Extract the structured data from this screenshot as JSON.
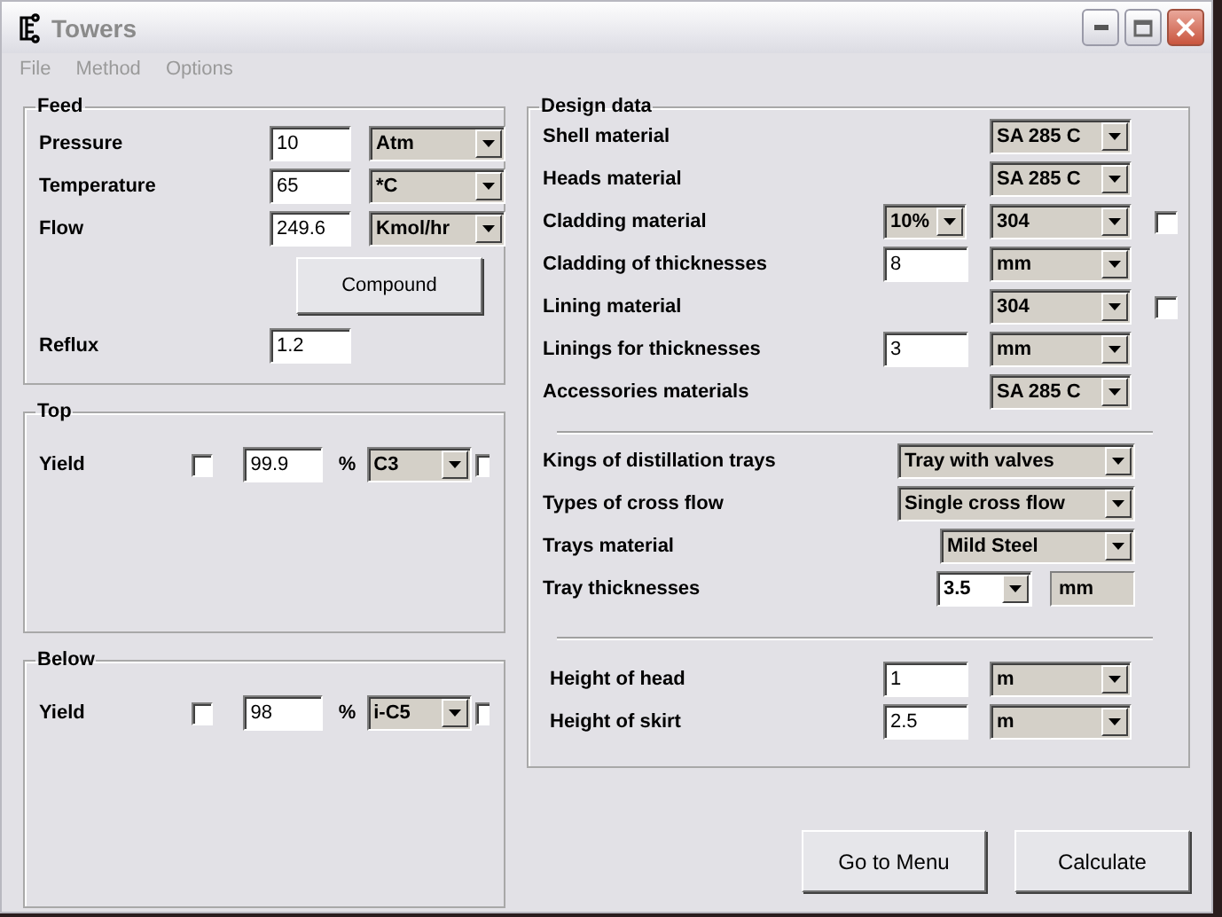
{
  "window": {
    "title": "Towers"
  },
  "menu": [
    "File",
    "Method",
    "Options"
  ],
  "feed": {
    "title": "Feed",
    "rows": [
      {
        "label": "Pressure",
        "value": "10",
        "unit": "Atm"
      },
      {
        "label": "Temperature",
        "value": "65",
        "unit": "*C"
      },
      {
        "label": "Flow",
        "value": "249.6",
        "unit": "Kmol/hr"
      }
    ],
    "button": "Compound",
    "reflux": {
      "label": "Reflux",
      "value": "1.2"
    }
  },
  "top": {
    "title": "Top",
    "label": "Yield",
    "checked": false,
    "value": "99.9",
    "sign": "%",
    "component": "C3",
    "side_checked": false
  },
  "below": {
    "title": "Below",
    "label": "Yield",
    "checked": false,
    "value": "98",
    "sign": "%",
    "component": "i-C5",
    "side_checked": false
  },
  "design": {
    "title": "Design data",
    "rows": [
      {
        "label": "Shell material",
        "fields": [
          {
            "kind": "combo",
            "value": "SA 285 C"
          }
        ]
      },
      {
        "label": "Heads material",
        "fields": [
          {
            "kind": "combo",
            "value": "SA 285 C"
          }
        ]
      },
      {
        "label": "Cladding material",
        "fields": [
          {
            "kind": "combo",
            "value": "10%"
          },
          {
            "kind": "combo",
            "value": "304"
          },
          {
            "kind": "check",
            "checked": false
          }
        ]
      },
      {
        "label": "Cladding of thicknesses",
        "fields": [
          {
            "kind": "text",
            "value": "8"
          },
          {
            "kind": "combo",
            "value": "mm"
          }
        ]
      },
      {
        "label": "Lining material",
        "fields": [
          {
            "kind": "combo",
            "value": "304"
          },
          {
            "kind": "check",
            "checked": false
          }
        ]
      },
      {
        "label": "Linings for thicknesses",
        "fields": [
          {
            "kind": "text",
            "value": "3"
          },
          {
            "kind": "combo",
            "value": "mm"
          }
        ]
      },
      {
        "label": "Accessories materials",
        "fields": [
          {
            "kind": "combo",
            "value": "SA 285 C"
          }
        ]
      }
    ],
    "trays": [
      {
        "label": "Kings of distillation trays",
        "fields": [
          {
            "kind": "combo",
            "value": "Tray with valves"
          }
        ]
      },
      {
        "label": "Types of cross flow",
        "fields": [
          {
            "kind": "combo",
            "value": "Single cross flow"
          }
        ]
      },
      {
        "label": "Trays material",
        "fields": [
          {
            "kind": "combo",
            "value": "Mild Steel"
          }
        ]
      },
      {
        "label": "Tray thicknesses",
        "fields": [
          {
            "kind": "editable",
            "value": "3.5"
          },
          {
            "kind": "readonly",
            "value": "mm"
          }
        ]
      }
    ],
    "heights": [
      {
        "label": "Height of head",
        "fields": [
          {
            "kind": "text",
            "value": "1"
          },
          {
            "kind": "combo",
            "value": "m"
          }
        ]
      },
      {
        "label": "Height of skirt",
        "fields": [
          {
            "kind": "text",
            "value": "2.5"
          },
          {
            "kind": "combo",
            "value": "m"
          }
        ]
      }
    ]
  },
  "buttons": [
    "Go to Menu",
    "Calculate"
  ]
}
